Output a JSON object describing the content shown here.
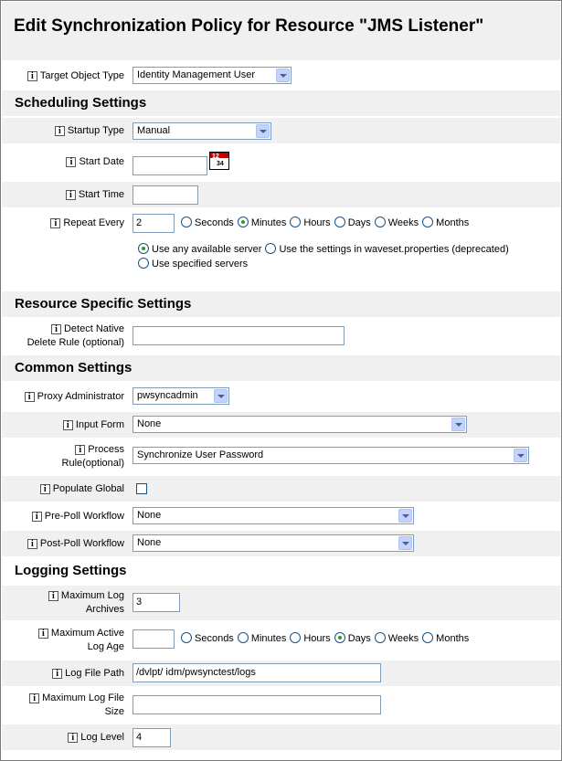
{
  "title": "Edit Synchronization Policy for Resource \"JMS Listener\"",
  "info_glyph": "i",
  "target_object_type": {
    "label": "Target Object Type",
    "value": "Identity Management User"
  },
  "scheduling": {
    "heading": "Scheduling Settings",
    "startup_type": {
      "label": "Startup Type",
      "value": "Manual"
    },
    "start_date": {
      "label": "Start Date",
      "value": ""
    },
    "start_time": {
      "label": "Start Time",
      "value": ""
    },
    "repeat_every": {
      "label": "Repeat Every",
      "value": "2",
      "units": [
        "Seconds",
        "Minutes",
        "Hours",
        "Days",
        "Weeks",
        "Months"
      ],
      "selected_unit": "Minutes"
    },
    "server_options": [
      "Use any available server",
      "Use the settings in waveset.properties (deprecated)",
      "Use specified servers"
    ],
    "selected_server_option": "Use any available server"
  },
  "resource_specific": {
    "heading": "Resource Specific Settings",
    "detect_native_delete_rule": {
      "label_line1": "Detect Native",
      "label_line2": "Delete Rule (optional)",
      "value": ""
    }
  },
  "common": {
    "heading": "Common Settings",
    "proxy_administrator": {
      "label": "Proxy Administrator",
      "value": "pwsyncadmin"
    },
    "input_form": {
      "label": "Input Form",
      "value": "None"
    },
    "process_rule": {
      "label_line1": "Process",
      "label_line2": "Rule(optional)",
      "value": "Synchronize User Password"
    },
    "populate_global": {
      "label": "Populate Global",
      "checked": false
    },
    "pre_poll_workflow": {
      "label": "Pre-Poll Workflow",
      "value": "None"
    },
    "post_poll_workflow": {
      "label": "Post-Poll Workflow",
      "value": "None"
    }
  },
  "logging": {
    "heading": "Logging Settings",
    "max_log_archives": {
      "label_line1": "Maximum Log",
      "label_line2": "Archives",
      "value": "3"
    },
    "max_active_log_age": {
      "label_line1": "Maximum Active",
      "label_line2": "Log Age",
      "value": "",
      "units": [
        "Seconds",
        "Minutes",
        "Hours",
        "Days",
        "Weeks",
        "Months"
      ],
      "selected_unit": "Days"
    },
    "log_file_path": {
      "label": "Log File Path",
      "value": "/dvlpt/ idm/pwsynctest/logs"
    },
    "max_log_file_size": {
      "label_line1": "Maximum Log File",
      "label_line2": "Size",
      "value": ""
    },
    "log_level": {
      "label": "Log Level",
      "value": "4"
    }
  },
  "calendar_icon_text": {
    "top": "12",
    "bottom": "34"
  },
  "colors": {
    "section_bg": "#f0f0f0",
    "border": "#7f9db9",
    "radio_selected": "#21a121",
    "calendar_red": "#c00000"
  }
}
